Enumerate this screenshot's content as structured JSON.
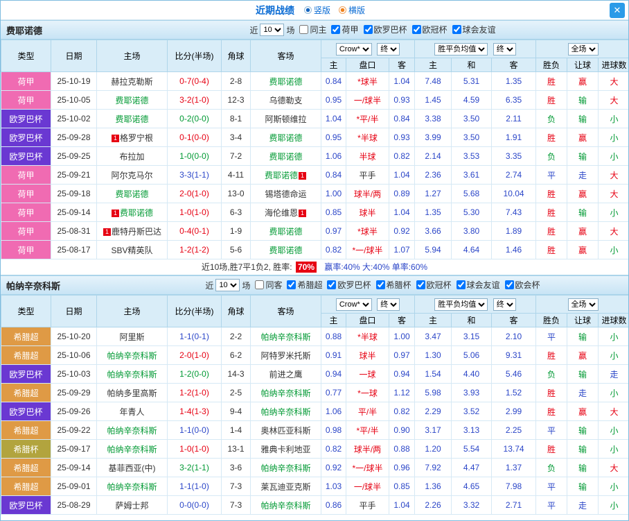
{
  "titlebar": {
    "title": "近期战绩",
    "radio_vertical": "竖版",
    "radio_horizontal": "横版",
    "close": "✕"
  },
  "colors": {
    "competitions": {
      "荷甲": "#f06bb2",
      "欧罗巴杯": "#6a38d2",
      "希腊超": "#df9a45",
      "希腊杯": "#b2a43e"
    },
    "win": "#e60012",
    "draw": "#2b46c8",
    "loss": "#009933",
    "odds": "#2b46c8",
    "header_bg": "#d9edf8"
  },
  "table_header": {
    "col_type": "类型",
    "col_date": "日期",
    "col_home": "主场",
    "col_score": "比分(半场)",
    "col_corner": "角球",
    "col_away": "客场",
    "odds_select": "Crow*",
    "final_select": "终",
    "avg_select": "胜平负均值",
    "scope_select": "全场",
    "sub_home": "主",
    "sub_handicap": "盘口",
    "sub_away": "客",
    "sub_draw": "和",
    "sub_result": "胜负",
    "sub_handicap_res": "让球",
    "sub_goals": "进球数"
  },
  "sections": [
    {
      "team": "费耶诺德",
      "filter": {
        "near": "近",
        "count": "10",
        "games": "场",
        "checks": [
          {
            "label": "同主",
            "checked": false
          },
          {
            "label": "荷甲",
            "checked": true
          },
          {
            "label": "欧罗巴杯",
            "checked": true
          },
          {
            "label": "欧冠杯",
            "checked": true
          },
          {
            "label": "球会友谊",
            "checked": true
          }
        ]
      },
      "rows": [
        {
          "comp": "荷甲",
          "date": "25-10-19",
          "home": {
            "text": "赫拉克勒斯",
            "subject": false
          },
          "score": "0-7(0-4)",
          "corner": "2-8",
          "away": {
            "text": "费耶诺德",
            "subject": true
          },
          "odds": [
            "0.84",
            "*球半",
            "1.04",
            "7.48",
            "5.31",
            "1.35"
          ],
          "results": [
            "胜",
            "赢",
            "大"
          ]
        },
        {
          "comp": "荷甲",
          "date": "25-10-05",
          "home": {
            "text": "费耶诺德",
            "subject": true
          },
          "score": "3-2(1-0)",
          "corner": "12-3",
          "away": {
            "text": "乌德勒支",
            "subject": false
          },
          "odds": [
            "0.95",
            "一/球半",
            "0.93",
            "1.45",
            "4.59",
            "6.35"
          ],
          "results": [
            "胜",
            "输",
            "大"
          ]
        },
        {
          "comp": "欧罗巴杯",
          "date": "25-10-02",
          "home": {
            "text": "费耶诺德",
            "subject": true
          },
          "score": "0-2(0-0)",
          "corner": "8-1",
          "away": {
            "text": "阿斯顿维拉",
            "subject": false
          },
          "odds": [
            "1.04",
            "*平/半",
            "0.84",
            "3.38",
            "3.50",
            "2.11"
          ],
          "results": [
            "负",
            "输",
            "小"
          ]
        },
        {
          "comp": "欧罗巴杯",
          "date": "25-09-28",
          "home": {
            "text": "格罗宁根",
            "subject": false,
            "badge": "1",
            "badgePos": "before"
          },
          "score": "0-1(0-0)",
          "corner": "3-4",
          "away": {
            "text": "费耶诺德",
            "subject": true
          },
          "odds": [
            "0.95",
            "*半球",
            "0.93",
            "3.99",
            "3.50",
            "1.91"
          ],
          "results": [
            "胜",
            "赢",
            "小"
          ]
        },
        {
          "comp": "欧罗巴杯",
          "date": "25-09-25",
          "home": {
            "text": "布拉加",
            "subject": false
          },
          "score": "1-0(0-0)",
          "corner": "7-2",
          "away": {
            "text": "费耶诺德",
            "subject": true
          },
          "odds": [
            "1.06",
            "半球",
            "0.82",
            "2.14",
            "3.53",
            "3.35"
          ],
          "results": [
            "负",
            "输",
            "小"
          ]
        },
        {
          "comp": "荷甲",
          "date": "25-09-21",
          "home": {
            "text": "阿尔克马尔",
            "subject": false
          },
          "score": "3-3(1-1)",
          "corner": "4-11",
          "away": {
            "text": "费耶诺德",
            "subject": true,
            "badge": "1",
            "badgePos": "after"
          },
          "odds": [
            "0.84",
            "平手",
            "1.04",
            "2.36",
            "3.61",
            "2.74"
          ],
          "results": [
            "平",
            "走",
            "大"
          ]
        },
        {
          "comp": "荷甲",
          "date": "25-09-18",
          "home": {
            "text": "费耶诺德",
            "subject": true
          },
          "score": "2-0(1-0)",
          "corner": "13-0",
          "away": {
            "text": "锡塔德命运",
            "subject": false
          },
          "odds": [
            "1.00",
            "球半/两",
            "0.89",
            "1.27",
            "5.68",
            "10.04"
          ],
          "results": [
            "胜",
            "赢",
            "大"
          ]
        },
        {
          "comp": "荷甲",
          "date": "25-09-14",
          "home": {
            "text": "费耶诺德",
            "subject": true,
            "badge": "1",
            "badgePos": "before"
          },
          "score": "1-0(1-0)",
          "corner": "6-3",
          "away": {
            "text": "海伦维恩",
            "subject": false,
            "badge": "1",
            "badgePos": "after"
          },
          "odds": [
            "0.85",
            "球半",
            "1.04",
            "1.35",
            "5.30",
            "7.43"
          ],
          "results": [
            "胜",
            "输",
            "小"
          ]
        },
        {
          "comp": "荷甲",
          "date": "25-08-31",
          "home": {
            "text": "鹿特丹斯巴达",
            "subject": false,
            "badge": "1",
            "badgePos": "before"
          },
          "score": "0-4(0-1)",
          "corner": "1-9",
          "away": {
            "text": "费耶诺德",
            "subject": true
          },
          "odds": [
            "0.97",
            "*球半",
            "0.92",
            "3.66",
            "3.80",
            "1.89"
          ],
          "results": [
            "胜",
            "赢",
            "大"
          ]
        },
        {
          "comp": "荷甲",
          "date": "25-08-17",
          "home": {
            "text": "SBV精英队",
            "subject": false
          },
          "score": "1-2(1-2)",
          "corner": "5-6",
          "away": {
            "text": "费耶诺德",
            "subject": true
          },
          "odds": [
            "0.82",
            "*一/球半",
            "1.07",
            "5.94",
            "4.64",
            "1.46"
          ],
          "results": [
            "胜",
            "赢",
            "小"
          ]
        }
      ],
      "summary": {
        "text": "近10场,胜7平1负2, 胜率:",
        "rate": "70%",
        "rest": "赢率:40% 大:40% 单率:60%"
      }
    },
    {
      "team": "帕纳辛奈科斯",
      "filter": {
        "near": "近",
        "count": "10",
        "games": "场",
        "checks": [
          {
            "label": "同客",
            "checked": false
          },
          {
            "label": "希腊超",
            "checked": true
          },
          {
            "label": "欧罗巴杯",
            "checked": true
          },
          {
            "label": "希腊杯",
            "checked": true
          },
          {
            "label": "欧冠杯",
            "checked": true
          },
          {
            "label": "球会友谊",
            "checked": true
          },
          {
            "label": "欧会杯",
            "checked": true
          }
        ]
      },
      "rows": [
        {
          "comp": "希腊超",
          "date": "25-10-20",
          "home": {
            "text": "阿里斯",
            "subject": false
          },
          "score": "1-1(0-1)",
          "corner": "2-2",
          "away": {
            "text": "帕纳辛奈科斯",
            "subject": true
          },
          "odds": [
            "0.88",
            "*半球",
            "1.00",
            "3.47",
            "3.15",
            "2.10"
          ],
          "results": [
            "平",
            "输",
            "小"
          ]
        },
        {
          "comp": "希腊超",
          "date": "25-10-06",
          "home": {
            "text": "帕纳辛奈科斯",
            "subject": true
          },
          "score": "2-0(1-0)",
          "corner": "6-2",
          "away": {
            "text": "阿特罗米托斯",
            "subject": false
          },
          "odds": [
            "0.91",
            "球半",
            "0.97",
            "1.30",
            "5.06",
            "9.31"
          ],
          "results": [
            "胜",
            "赢",
            "小"
          ]
        },
        {
          "comp": "欧罗巴杯",
          "date": "25-10-03",
          "home": {
            "text": "帕纳辛奈科斯",
            "subject": true
          },
          "score": "1-2(0-0)",
          "corner": "14-3",
          "away": {
            "text": "前进之鹰",
            "subject": false
          },
          "odds": [
            "0.94",
            "一球",
            "0.94",
            "1.54",
            "4.40",
            "5.46"
          ],
          "results": [
            "负",
            "输",
            "走"
          ]
        },
        {
          "comp": "希腊超",
          "date": "25-09-29",
          "home": {
            "text": "帕纳多里高斯",
            "subject": false
          },
          "score": "1-2(1-0)",
          "corner": "2-5",
          "away": {
            "text": "帕纳辛奈科斯",
            "subject": true
          },
          "odds": [
            "0.77",
            "*一球",
            "1.12",
            "5.98",
            "3.93",
            "1.52"
          ],
          "results": [
            "胜",
            "走",
            "小"
          ]
        },
        {
          "comp": "欧罗巴杯",
          "date": "25-09-26",
          "home": {
            "text": "年青人",
            "subject": false
          },
          "score": "1-4(1-3)",
          "corner": "9-4",
          "away": {
            "text": "帕纳辛奈科斯",
            "subject": true
          },
          "odds": [
            "1.06",
            "平/半",
            "0.82",
            "2.29",
            "3.52",
            "2.99"
          ],
          "results": [
            "胜",
            "赢",
            "大"
          ]
        },
        {
          "comp": "希腊超",
          "date": "25-09-22",
          "home": {
            "text": "帕纳辛奈科斯",
            "subject": true
          },
          "score": "1-1(0-0)",
          "corner": "1-4",
          "away": {
            "text": "奥林匹亚科斯",
            "subject": false
          },
          "odds": [
            "0.98",
            "*平/半",
            "0.90",
            "3.17",
            "3.13",
            "2.25"
          ],
          "results": [
            "平",
            "输",
            "小"
          ]
        },
        {
          "comp": "希腊杯",
          "date": "25-09-17",
          "home": {
            "text": "帕纳辛奈科斯",
            "subject": true
          },
          "score": "1-0(1-0)",
          "corner": "13-1",
          "away": {
            "text": "雅典卡利地亚",
            "subject": false
          },
          "odds": [
            "0.82",
            "球半/两",
            "0.88",
            "1.20",
            "5.54",
            "13.74"
          ],
          "results": [
            "胜",
            "输",
            "小"
          ]
        },
        {
          "comp": "希腊超",
          "date": "25-09-14",
          "home": {
            "text": "基菲西亚(中)",
            "subject": false
          },
          "score": "3-2(1-1)",
          "corner": "3-6",
          "away": {
            "text": "帕纳辛奈科斯",
            "subject": true
          },
          "odds": [
            "0.92",
            "*一/球半",
            "0.96",
            "7.92",
            "4.47",
            "1.37"
          ],
          "results": [
            "负",
            "输",
            "大"
          ]
        },
        {
          "comp": "希腊超",
          "date": "25-09-01",
          "home": {
            "text": "帕纳辛奈科斯",
            "subject": true
          },
          "score": "1-1(1-0)",
          "corner": "7-3",
          "away": {
            "text": "莱瓦迪亚克斯",
            "subject": false
          },
          "odds": [
            "1.03",
            "一/球半",
            "0.85",
            "1.36",
            "4.65",
            "7.98"
          ],
          "results": [
            "平",
            "输",
            "小"
          ]
        },
        {
          "comp": "欧罗巴杯",
          "date": "25-08-29",
          "home": {
            "text": "萨姆士邦",
            "subject": false
          },
          "score": "0-0(0-0)",
          "corner": "7-3",
          "away": {
            "text": "帕纳辛奈科斯",
            "subject": true
          },
          "odds": [
            "0.86",
            "平手",
            "1.04",
            "2.26",
            "3.32",
            "2.71"
          ],
          "results": [
            "平",
            "走",
            "小"
          ]
        }
      ]
    }
  ]
}
